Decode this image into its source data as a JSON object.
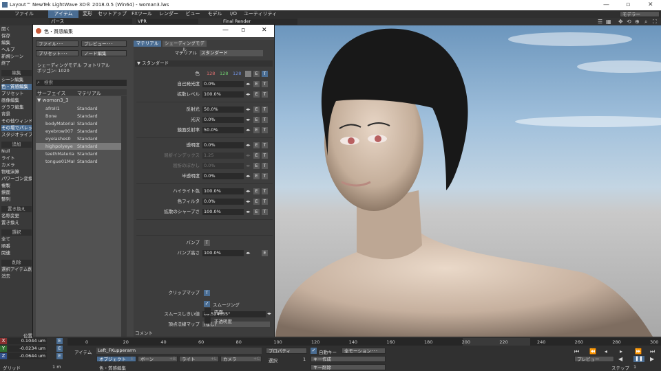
{
  "app": {
    "title": "Layout™ NewTek LightWave 3D® 2018.0.5 (Win64) - woman3.lws",
    "modeler_btn": "モデラー",
    "f10": "F10"
  },
  "menu": [
    "ファイル",
    "アイテム",
    "変形",
    "セットアップ",
    "FXツール",
    "レンダー",
    "ビュー",
    "モデル",
    "I/O",
    "ユーティリティ"
  ],
  "toolbar": {
    "view": "パース",
    "vpr": "VPR",
    "render": "Final Render"
  },
  "sidebar": [
    {
      "label": "開く",
      "t": "n"
    },
    {
      "label": "保存",
      "t": "n"
    },
    {
      "label": "編集",
      "t": "n"
    },
    {
      "label": "ヘルプ",
      "t": "n"
    },
    {
      "label": "新規シーン",
      "t": "n"
    },
    {
      "label": "終了",
      "t": "n"
    },
    {
      "label": "編集",
      "t": "h"
    },
    {
      "label": "シーン編集",
      "t": "n"
    },
    {
      "label": "色・質感編集",
      "t": "s"
    },
    {
      "label": "プリセット",
      "t": "n"
    },
    {
      "label": "画像編集",
      "t": "n"
    },
    {
      "label": "グラフ編集",
      "t": "n"
    },
    {
      "label": "背景",
      "t": "n"
    },
    {
      "label": "その他ウィンドウ",
      "t": "n"
    },
    {
      "label": "その場でパレット",
      "t": "s"
    },
    {
      "label": "スタジオライブ",
      "t": "n"
    },
    {
      "label": "追加",
      "t": "h"
    },
    {
      "label": "Null",
      "t": "n"
    },
    {
      "label": "ライト",
      "t": "n"
    },
    {
      "label": "カメラ",
      "t": "n"
    },
    {
      "label": "物理演算",
      "t": "n"
    },
    {
      "label": "パワーゴン変換",
      "t": "n"
    },
    {
      "label": "複製",
      "t": "n"
    },
    {
      "label": "鏡面",
      "t": "n"
    },
    {
      "label": "整列",
      "t": "n"
    },
    {
      "label": "置き換え",
      "t": "h"
    },
    {
      "label": "名称変更",
      "t": "n"
    },
    {
      "label": "置き換え",
      "t": "n"
    },
    {
      "label": "選択",
      "t": "h"
    },
    {
      "label": "全て",
      "t": "n"
    },
    {
      "label": "順番",
      "t": "n"
    },
    {
      "label": "関連",
      "t": "n"
    },
    {
      "label": "削除",
      "t": "h"
    },
    {
      "label": "選択アイテム削除",
      "t": "n"
    },
    {
      "label": "消去",
      "t": "n"
    }
  ],
  "panel": {
    "title": "色・質感編集",
    "file_btn": "ファイル･･･",
    "preview_btn": "プレビュー･･･",
    "preset_btn": "プリセット･･･",
    "node_btn": "ノード編集",
    "tab_material": "マテリアル",
    "tab_shading": "シェーディングモデル",
    "shading_model": "シェーディングモデル フォトリアル",
    "polygons": "ポリゴン: 1020",
    "search_placeholder": "検索",
    "col_surface": "サーフェイス",
    "col_material": "マテリアル",
    "group": "▼ woman3_3",
    "surfaces": [
      {
        "name": "afroII1",
        "mat": "Standard"
      },
      {
        "name": "Bone",
        "mat": "Standard"
      },
      {
        "name": "bodyMaterial",
        "mat": "Standard"
      },
      {
        "name": "eyebrow007",
        "mat": "Standard"
      },
      {
        "name": "eyelashes0",
        "mat": "Standard"
      },
      {
        "name": "highpolyeye",
        "mat": "Standard"
      },
      {
        "name": "teethMaterial",
        "mat": "Standard"
      },
      {
        "name": "tongue01Mat",
        "mat": "Standard"
      }
    ],
    "material_label": "マテリアル",
    "material_value": "スタンダード",
    "section": "▼ スタンダード",
    "color": {
      "label": "色",
      "r": "128",
      "g": "128",
      "b": "128"
    },
    "props": [
      {
        "label": "自己発光度",
        "value": "0.0%",
        "dim": false
      },
      {
        "label": "拡散レベル",
        "value": "100.0%",
        "dim": false
      },
      {
        "label": "反射光",
        "value": "50.0%",
        "dim": false
      },
      {
        "label": "光沢",
        "value": "0.0%",
        "dim": false
      },
      {
        "label": "鏡面反射率",
        "value": "50.0%",
        "dim": false
      },
      {
        "label": "透明度",
        "value": "0.0%",
        "dim": false
      },
      {
        "label": "屈折インデックス",
        "value": "1.25",
        "dim": true
      },
      {
        "label": "屈折のぼかし",
        "value": "0.0%",
        "dim": true
      },
      {
        "label": "半透明度",
        "value": "0.0%",
        "dim": false
      },
      {
        "label": "ハイライト色",
        "value": "100.0%",
        "dim": false
      },
      {
        "label": "色フィルタ",
        "value": "0.0%",
        "dim": false
      },
      {
        "label": "拡散のシャープさ",
        "value": "100.0%",
        "dim": false
      }
    ],
    "bump_label": "バンプ",
    "bump_height_label": "バンプ高さ",
    "bump_height": "100.0%",
    "clip_label": "クリップマップ",
    "smoothing": "スムージング",
    "smooth_thresh_label": "スムースしきい値",
    "smooth_thresh": "89.524655°",
    "normal_map_label": "頂点法線マップ",
    "normal_map": "(なし)",
    "double_sided": "両面",
    "opaque": "不透明度",
    "comment": "コメント",
    "btn_t": "T",
    "btn_e": "E"
  },
  "bottom": {
    "pos": "位置",
    "x": {
      "axis": "X",
      "value": "0.1044 um"
    },
    "y": {
      "axis": "Y",
      "value": "-0.0234 um"
    },
    "z": {
      "axis": "Z",
      "value": "-0.0644 um"
    },
    "grid": "グリッド",
    "grid_value": "1 m",
    "ticks": [
      "0",
      "20",
      "40",
      "60",
      "80",
      "100",
      "120",
      "140",
      "160",
      "180",
      "200",
      "220",
      "240",
      "260",
      "280",
      "300"
    ],
    "item_label": "アイテム",
    "item_value": "Left_FKupperarm",
    "objects": "オブジェクト",
    "bones": "ボーン",
    "lights": "ライト",
    "cameras": "カメラ",
    "prop": "プロパティ",
    "sel": "選択",
    "sel_num": "1",
    "autokey": "自動キー",
    "allmotion": "全モーション･･･",
    "create_key": "キー作成",
    "delete_key": "キー削除",
    "set": "set",
    "del": "del",
    "preview": "プレビュー",
    "step": "ステップ",
    "step_val": "1",
    "status": "色・質感編集",
    "shortcut_b": "+B",
    "shortcut_l": "+L",
    "shortcut_c": "+C",
    "shortcut_p": "p"
  }
}
